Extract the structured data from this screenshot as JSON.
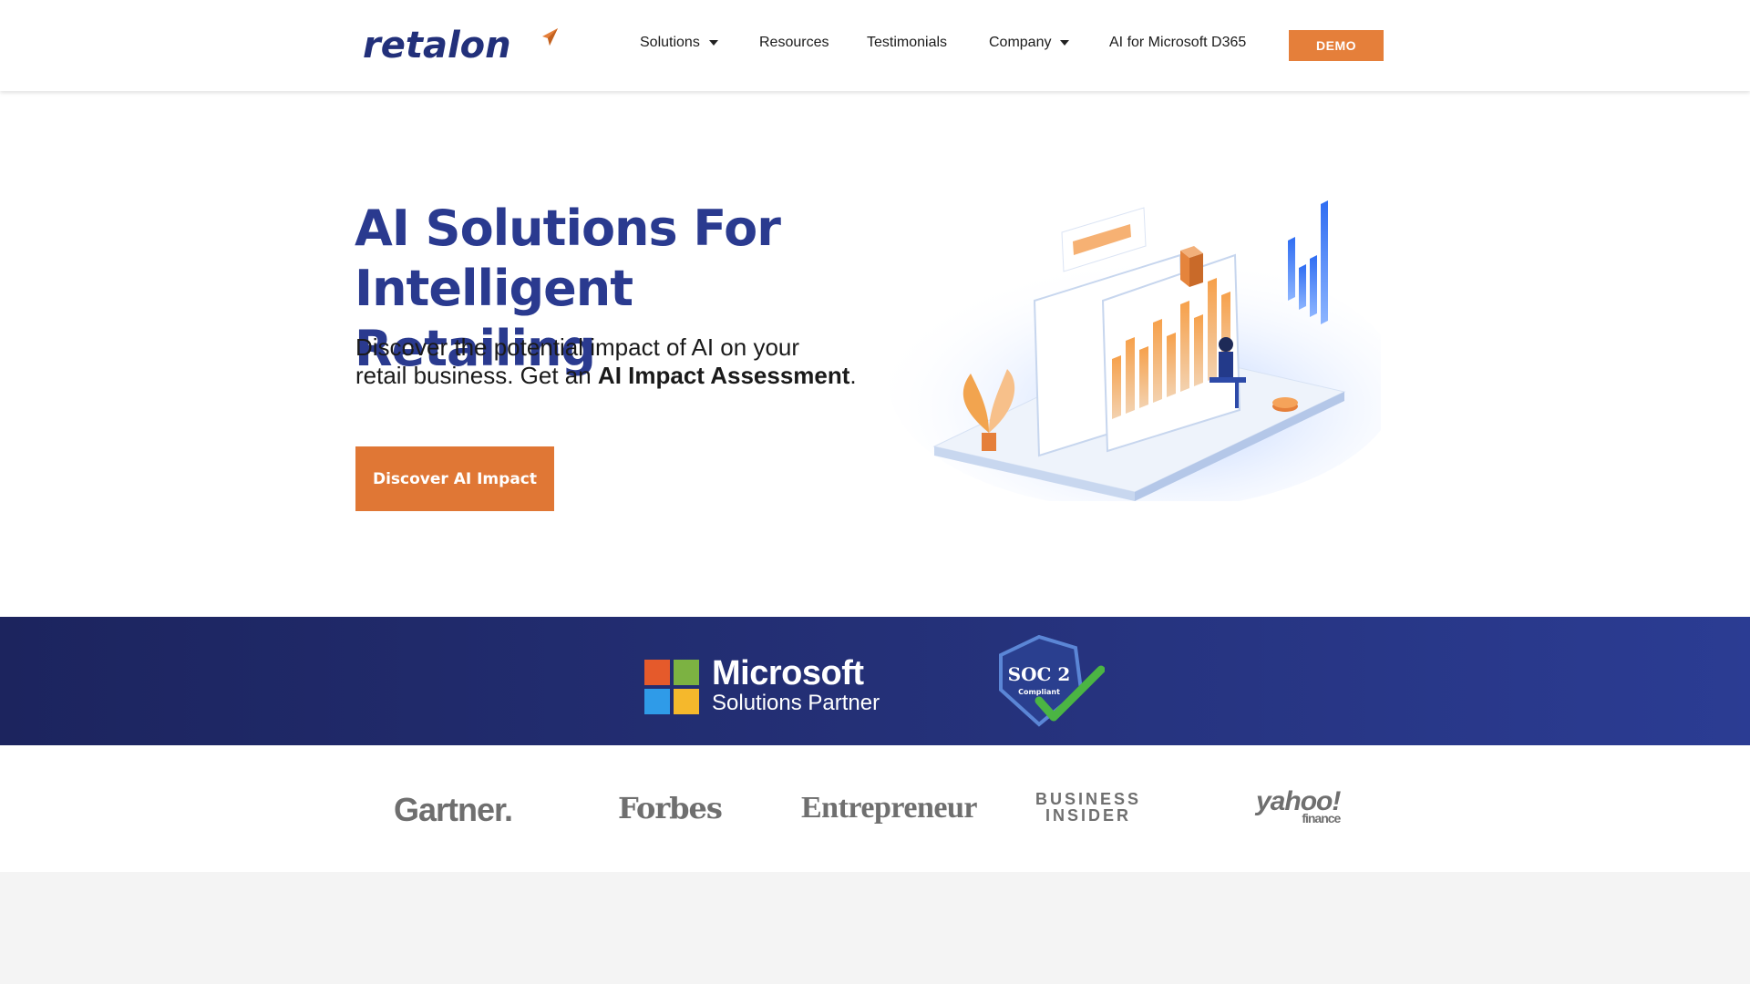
{
  "brand": {
    "name": "retalon",
    "colors": {
      "primary": "#2a3a8f",
      "accent": "#e57f3a",
      "band": "#243077"
    }
  },
  "nav": {
    "items": [
      {
        "label": "Solutions",
        "dropdown": true
      },
      {
        "label": "Resources",
        "dropdown": false
      },
      {
        "label": "Testimonials",
        "dropdown": false
      },
      {
        "label": "Company",
        "dropdown": true
      },
      {
        "label": "AI for Microsoft D365",
        "dropdown": false
      }
    ],
    "demo_label": "DEMO"
  },
  "hero": {
    "title_line1": "AI Solutions For",
    "title_line2": "Intelligent Retailing",
    "subtitle_line1": "Discover the potential impact of AI on your",
    "subtitle_line2_prefix": "retail business. Get an ",
    "subtitle_emphasis": "AI Impact Assessment",
    "subtitle_suffix": ".",
    "cta_label": "Discover AI Impact",
    "illustration": "analytics-dashboard-illustration"
  },
  "partners": {
    "microsoft_line1": "Microsoft",
    "microsoft_line2": "Solutions Partner",
    "soc_title": "SOC 2",
    "soc_sub": "Compliant"
  },
  "press": {
    "gartner": "Gartner.",
    "forbes": "Forbes",
    "entrepreneur": "Entrepreneur",
    "business_line1": "BUSINESS",
    "business_line2": "INSIDER",
    "yahoo": "yahoo!",
    "yahoo_sub": "finance"
  }
}
